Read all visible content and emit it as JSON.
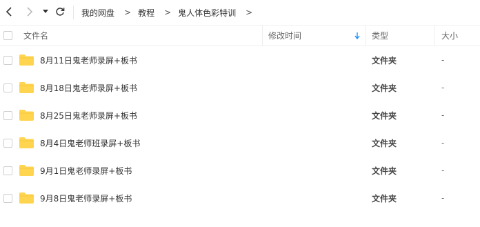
{
  "nav": {
    "back_icon": "chevron-left-icon",
    "forward_icon": "chevron-right-icon",
    "history_icon": "caret-down-icon",
    "refresh_icon": "refresh-icon"
  },
  "breadcrumb": {
    "items": [
      "我的网盘",
      "教程",
      "鬼人体色彩特训"
    ],
    "separator": ">"
  },
  "table": {
    "columns": {
      "name": "文件名",
      "modified": "修改时间",
      "type": "类型",
      "size": "大小"
    },
    "sort_icon": "arrow-down-icon",
    "folder_color": "#ffd44f",
    "rows": [
      {
        "name": "8月11日鬼老师录屏+板书",
        "modified": "",
        "type": "文件夹",
        "size": "-"
      },
      {
        "name": "8月18日鬼老师录屏+板书",
        "modified": "",
        "type": "文件夹",
        "size": "-"
      },
      {
        "name": "8月25日鬼老师录屏+板书",
        "modified": "",
        "type": "文件夹",
        "size": "-"
      },
      {
        "name": "8月4日鬼老师班录屏+板书",
        "modified": "",
        "type": "文件夹",
        "size": "-"
      },
      {
        "name": "9月1日鬼老师录屏+板书",
        "modified": "",
        "type": "文件夹",
        "size": "-"
      },
      {
        "name": "9月8日鬼老师录屏+板书",
        "modified": "",
        "type": "文件夹",
        "size": "-"
      }
    ]
  }
}
